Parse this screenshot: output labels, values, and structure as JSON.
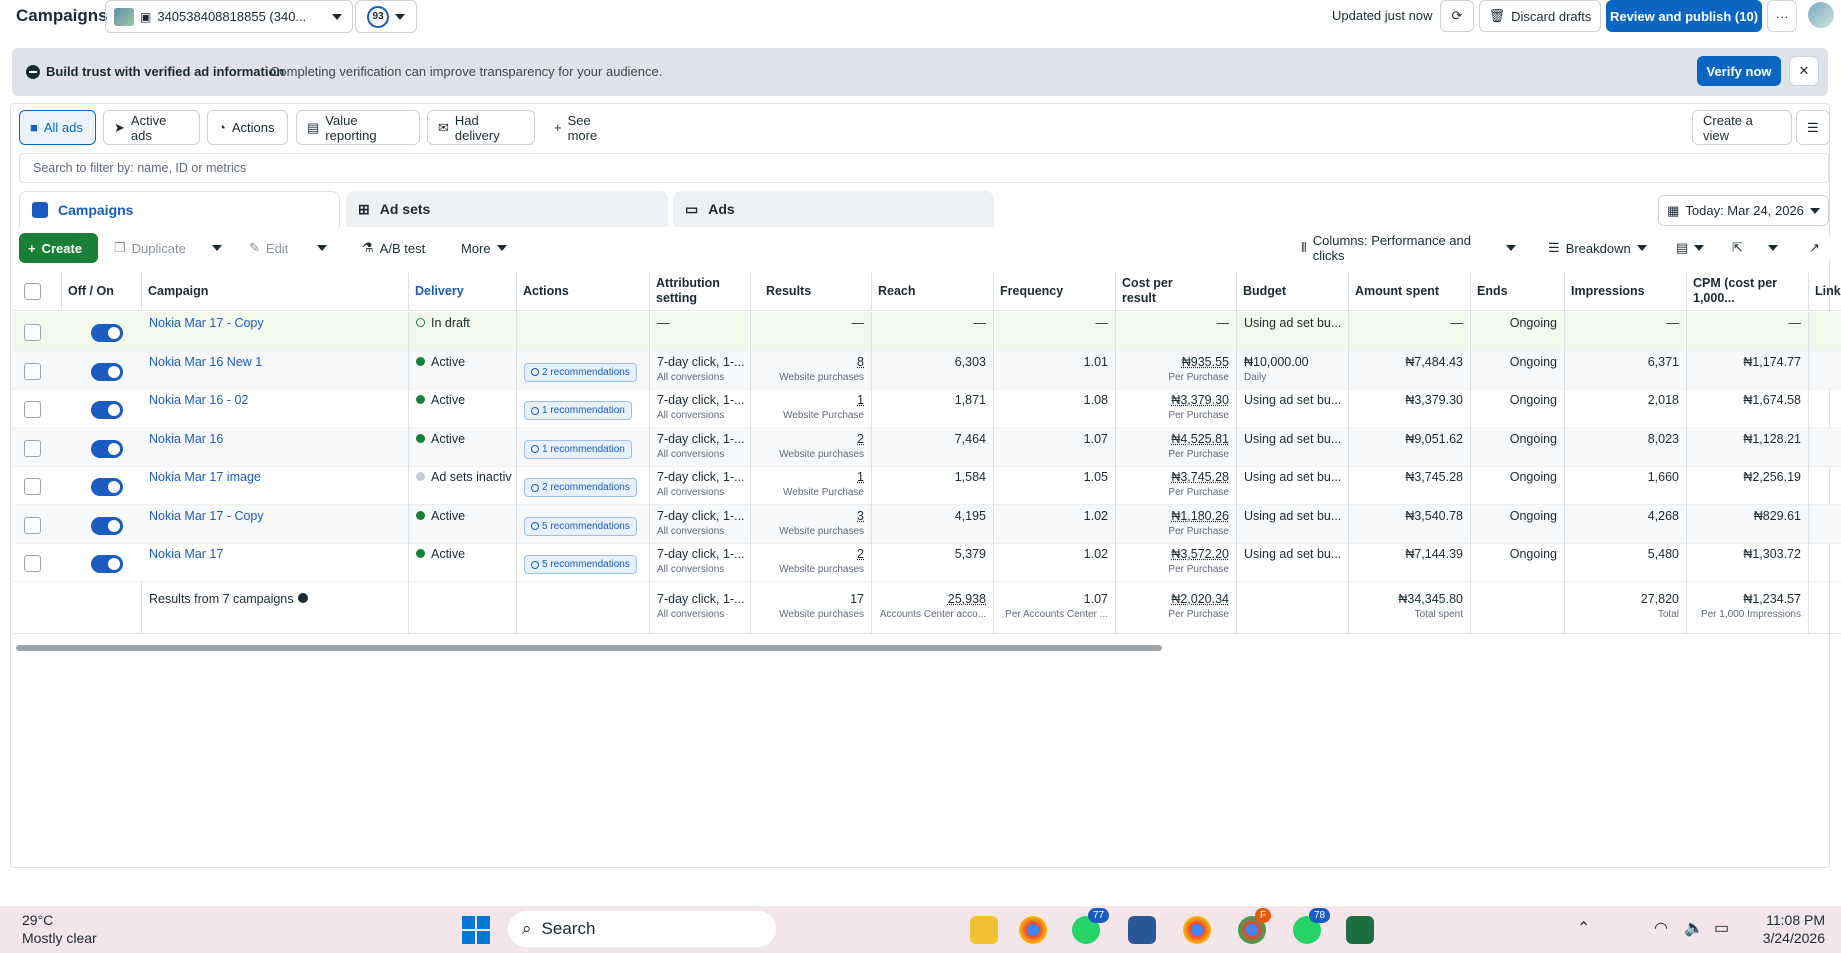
{
  "header": {
    "title": "Campaigns",
    "account": "340538408818855 (340...",
    "score": "93",
    "updated": "Updated just now",
    "discard": "Discard drafts",
    "review": "Review and publish (10)",
    "more": "···"
  },
  "banner": {
    "title": "Build trust with verified ad information",
    "text": "Completing verification can improve transparency for your audience.",
    "verify": "Verify now"
  },
  "filters": [
    "All ads",
    "Active ads",
    "Actions",
    "Value reporting",
    "Had delivery",
    "See more"
  ],
  "create_view": "Create a view",
  "search_placeholder": "Search to filter by: name, ID or metrics",
  "tabs": [
    "Campaigns",
    "Ad sets",
    "Ads"
  ],
  "date": "Today: Mar 24, 2026",
  "toolbar": {
    "create": "Create",
    "duplicate": "Duplicate",
    "edit": "Edit",
    "ab": "A/B test",
    "more": "More",
    "columns": "Columns: Performance and clicks",
    "breakdown": "Breakdown"
  },
  "columns": [
    "Off / On",
    "Campaign",
    "Delivery",
    "Actions",
    "Attribution setting",
    "Results",
    "Reach",
    "Frequency",
    "Cost per result",
    "Budget",
    "Amount spent",
    "Ends",
    "Impressions",
    "CPM (cost per 1,000...",
    "Link c"
  ],
  "rows": [
    {
      "name": "Nokia Mar 17 - Copy",
      "delivery": "In draft",
      "status": "draft",
      "actions": "",
      "attr": "—",
      "attr_sub": "",
      "results": "—",
      "results_sub": "",
      "reach": "—",
      "freq": "—",
      "cpr": "—",
      "cpr_sub": "",
      "budget": "Using ad set bu...",
      "budget_sub": "",
      "spent": "—",
      "ends": "Ongoing",
      "impr": "—",
      "cpm": "—"
    },
    {
      "name": "Nokia Mar 16 New 1",
      "delivery": "Active",
      "status": "active",
      "actions": "2 recommendations",
      "attr": "7-day click, 1-...",
      "attr_sub": "All conversions",
      "results": "8",
      "results_sub": "Website purchases",
      "reach": "6,303",
      "freq": "1.01",
      "cpr": "₦935.55",
      "cpr_sub": "Per Purchase",
      "budget": "₦10,000.00",
      "budget_sub": "Daily",
      "spent": "₦7,484.43",
      "ends": "Ongoing",
      "impr": "6,371",
      "cpm": "₦1,174.77"
    },
    {
      "name": "Nokia Mar 16 - 02",
      "delivery": "Active",
      "status": "active",
      "actions": "1 recommendation",
      "attr": "7-day click, 1-...",
      "attr_sub": "All conversions",
      "results": "1",
      "results_sub": "Website Purchase",
      "reach": "1,871",
      "freq": "1.08",
      "cpr": "₦3,379.30",
      "cpr_sub": "Per Purchase",
      "budget": "Using ad set bu...",
      "budget_sub": "",
      "spent": "₦3,379.30",
      "ends": "Ongoing",
      "impr": "2,018",
      "cpm": "₦1,674.58"
    },
    {
      "name": "Nokia Mar 16",
      "delivery": "Active",
      "status": "active",
      "actions": "1 recommendation",
      "attr": "7-day click, 1-...",
      "attr_sub": "All conversions",
      "results": "2",
      "results_sub": "Website purchases",
      "reach": "7,464",
      "freq": "1.07",
      "cpr": "₦4,525.81",
      "cpr_sub": "Per Purchase",
      "budget": "Using ad set bu...",
      "budget_sub": "",
      "spent": "₦9,051.62",
      "ends": "Ongoing",
      "impr": "8,023",
      "cpm": "₦1,128.21"
    },
    {
      "name": "Nokia Mar 17 image",
      "delivery": "Ad sets inactiv",
      "status": "inactive",
      "actions": "2 recommendations",
      "attr": "7-day click, 1-...",
      "attr_sub": "All conversions",
      "results": "1",
      "results_sub": "Website Purchase",
      "reach": "1,584",
      "freq": "1.05",
      "cpr": "₦3,745.28",
      "cpr_sub": "Per Purchase",
      "budget": "Using ad set bu...",
      "budget_sub": "",
      "spent": "₦3,745.28",
      "ends": "Ongoing",
      "impr": "1,660",
      "cpm": "₦2,256.19"
    },
    {
      "name": "Nokia Mar 17 - Copy",
      "delivery": "Active",
      "status": "active",
      "actions": "5 recommendations",
      "attr": "7-day click, 1-...",
      "attr_sub": "All conversions",
      "results": "3",
      "results_sub": "Website purchases",
      "reach": "4,195",
      "freq": "1.02",
      "cpr": "₦1,180.26",
      "cpr_sub": "Per Purchase",
      "budget": "Using ad set bu...",
      "budget_sub": "",
      "spent": "₦3,540.78",
      "ends": "Ongoing",
      "impr": "4,268",
      "cpm": "₦829.61"
    },
    {
      "name": "Nokia Mar 17",
      "delivery": "Active",
      "status": "active",
      "actions": "5 recommendations",
      "attr": "7-day click, 1-...",
      "attr_sub": "All conversions",
      "results": "2",
      "results_sub": "Website purchases",
      "reach": "5,379",
      "freq": "1.02",
      "cpr": "₦3,572.20",
      "cpr_sub": "Per Purchase",
      "budget": "Using ad set bu...",
      "budget_sub": "",
      "spent": "₦7,144.39",
      "ends": "Ongoing",
      "impr": "5,480",
      "cpm": "₦1,303.72"
    }
  ],
  "totals": {
    "label": "Results from 7 campaigns",
    "attr": "7-day click, 1-...",
    "attr_sub": "All conversions",
    "results": "17",
    "results_sub": "Website purchases",
    "reach": "25,938",
    "reach_sub": "Accounts Center acco...",
    "freq": "1.07",
    "freq_sub": "Per Accounts Center ...",
    "cpr": "₦2,020.34",
    "cpr_sub": "Per Purchase",
    "spent": "₦34,345.80",
    "spent_sub": "Total spent",
    "impr": "27,820",
    "impr_sub": "Total",
    "cpm": "₦1,234.57",
    "cpm_sub": "Per 1,000 Impressions"
  },
  "taskbar": {
    "temp": "29°C",
    "weather": "Mostly clear",
    "search": "Search",
    "time": "11:08 PM",
    "date": "3/24/2026",
    "badge1": "77",
    "badge2": "78",
    "badge3": "F"
  }
}
